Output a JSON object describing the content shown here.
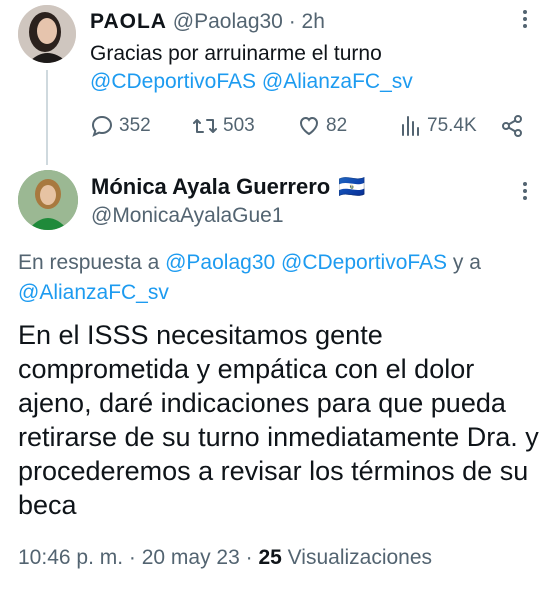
{
  "tweet1": {
    "name": "PAOLA",
    "handle": "@Paolag30",
    "time": "· 2h",
    "text": "Gracias por arruinarme el turno",
    "mentions": "@CDeportivoFAS @AlianzaFC_sv",
    "stats": {
      "replies": "352",
      "retweets": "503",
      "likes": "82",
      "views": "75.4K"
    }
  },
  "tweet2": {
    "name": "Mónica Ayala Guerrero",
    "flag": "🇸🇻",
    "handle": "@MonicaAyalaGue1",
    "reply_prefix": "En respuesta a",
    "reply_mentions": "@Paolag30 @CDeportivoFAS",
    "reply_and": "y a",
    "reply_mention_last": "@AlianzaFC_sv",
    "text": "En el ISSS necesitamos gente comprometida y empática con el dolor ajeno, daré indicaciones para que pueda retirarse de su turno inmediatamente Dra. y procederemos a revisar los términos de su beca",
    "time": "10:46 p. m.",
    "date": "20 may 23",
    "views_count": "25",
    "views_label": "Visualizaciones"
  },
  "icons": [
    "reply-icon",
    "retweet-icon",
    "like-icon",
    "views-icon",
    "share-icon",
    "more-icon"
  ]
}
